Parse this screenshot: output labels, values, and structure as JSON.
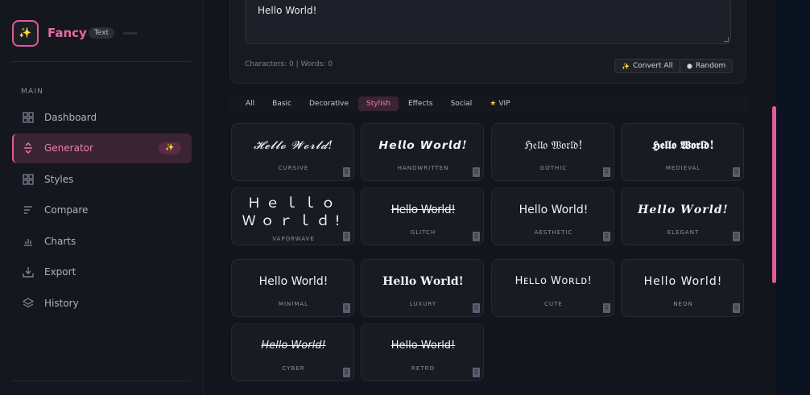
{
  "brand": {
    "logo_icon": "sparkle-wand-icon",
    "name": "Fancy",
    "badge": "Text"
  },
  "sidebar": {
    "section_label": "MAIN",
    "items": [
      {
        "label": "Dashboard",
        "icon": "grid-icon"
      },
      {
        "label": "Generator",
        "icon": "text-generator-icon",
        "active": true,
        "pill": "✨"
      },
      {
        "label": "Styles",
        "icon": "grid-icon"
      },
      {
        "label": "Compare",
        "icon": "lines-icon"
      },
      {
        "label": "Charts",
        "icon": "bar-chart-icon"
      },
      {
        "label": "Export",
        "icon": "download-icon"
      },
      {
        "label": "History",
        "icon": "layers-icon"
      }
    ]
  },
  "editor": {
    "text": "Hello World!",
    "stats": "Characters: 0 | Words: 0",
    "convert_all": "Convert All",
    "random": "Random"
  },
  "tabs": [
    {
      "label": "All"
    },
    {
      "label": "Basic"
    },
    {
      "label": "Decorative"
    },
    {
      "label": "Stylish",
      "active": true
    },
    {
      "label": "Effects"
    },
    {
      "label": "Social"
    },
    {
      "label": "VIP",
      "star": "★"
    }
  ],
  "styles": [
    {
      "text": "𝓗𝓮𝓵𝓵𝓸 𝓦𝓸𝓻𝓵𝓭!",
      "label": "CURSIVE",
      "cls": "s-cursive"
    },
    {
      "text": "𝙃𝙚𝙡𝙡𝙤 𝙒𝙤𝙧𝙡𝙙!",
      "label": "HANDWRITTEN",
      "cls": "s-hand"
    },
    {
      "text": "ℌ𝔢𝔩𝔩𝔬 𝔚𝔬𝔯𝔩𝔡!",
      "label": "GOTHIC",
      "cls": "s-gothic"
    },
    {
      "text": "𝕳𝖊𝖑𝖑𝖔 𝖂𝖔𝖗𝖑𝖉!",
      "label": "MEDIEVAL",
      "cls": "s-medieval"
    },
    {
      "text": "Ｈｅｌｌｏ Ｗｏｒｌｄ!",
      "label": "VAPORWAVE",
      "cls": "s-vapor"
    },
    {
      "text": "Hello World!",
      "label": "GLITCH",
      "cls": "s-glitch"
    },
    {
      "text": "Hello World!",
      "label": "AESTHETIC",
      "cls": "s-aesthetic"
    },
    {
      "text": "𝑯𝒆𝒍𝒍𝒐 𝑾𝒐𝒓𝒍𝒅!",
      "label": "ELEGANT",
      "cls": "s-elegant"
    },
    {
      "text": "Hello World!",
      "label": "MINIMAL",
      "cls": "s-minimal"
    },
    {
      "text": "𝐇𝐞𝐥𝐥𝐨 𝐖𝐨𝐫𝐥𝐝!",
      "label": "LUXURY",
      "cls": "s-luxury"
    },
    {
      "text": "Hᴇʟʟᴏ Wᴏʀʟᴅ!",
      "label": "CUTE",
      "cls": "s-cute"
    },
    {
      "text": "Hello World!",
      "label": "NEON",
      "cls": "s-neon"
    },
    {
      "text": "Hello World!",
      "label": "CYBER",
      "cls": "s-cyber"
    },
    {
      "text": "Hello World!",
      "label": "RETRO",
      "cls": "s-retro"
    }
  ],
  "colors": {
    "accent": "#e25a99",
    "accent_text": "#ef7fb3",
    "background": "#13151c",
    "star": "#f5c242"
  }
}
